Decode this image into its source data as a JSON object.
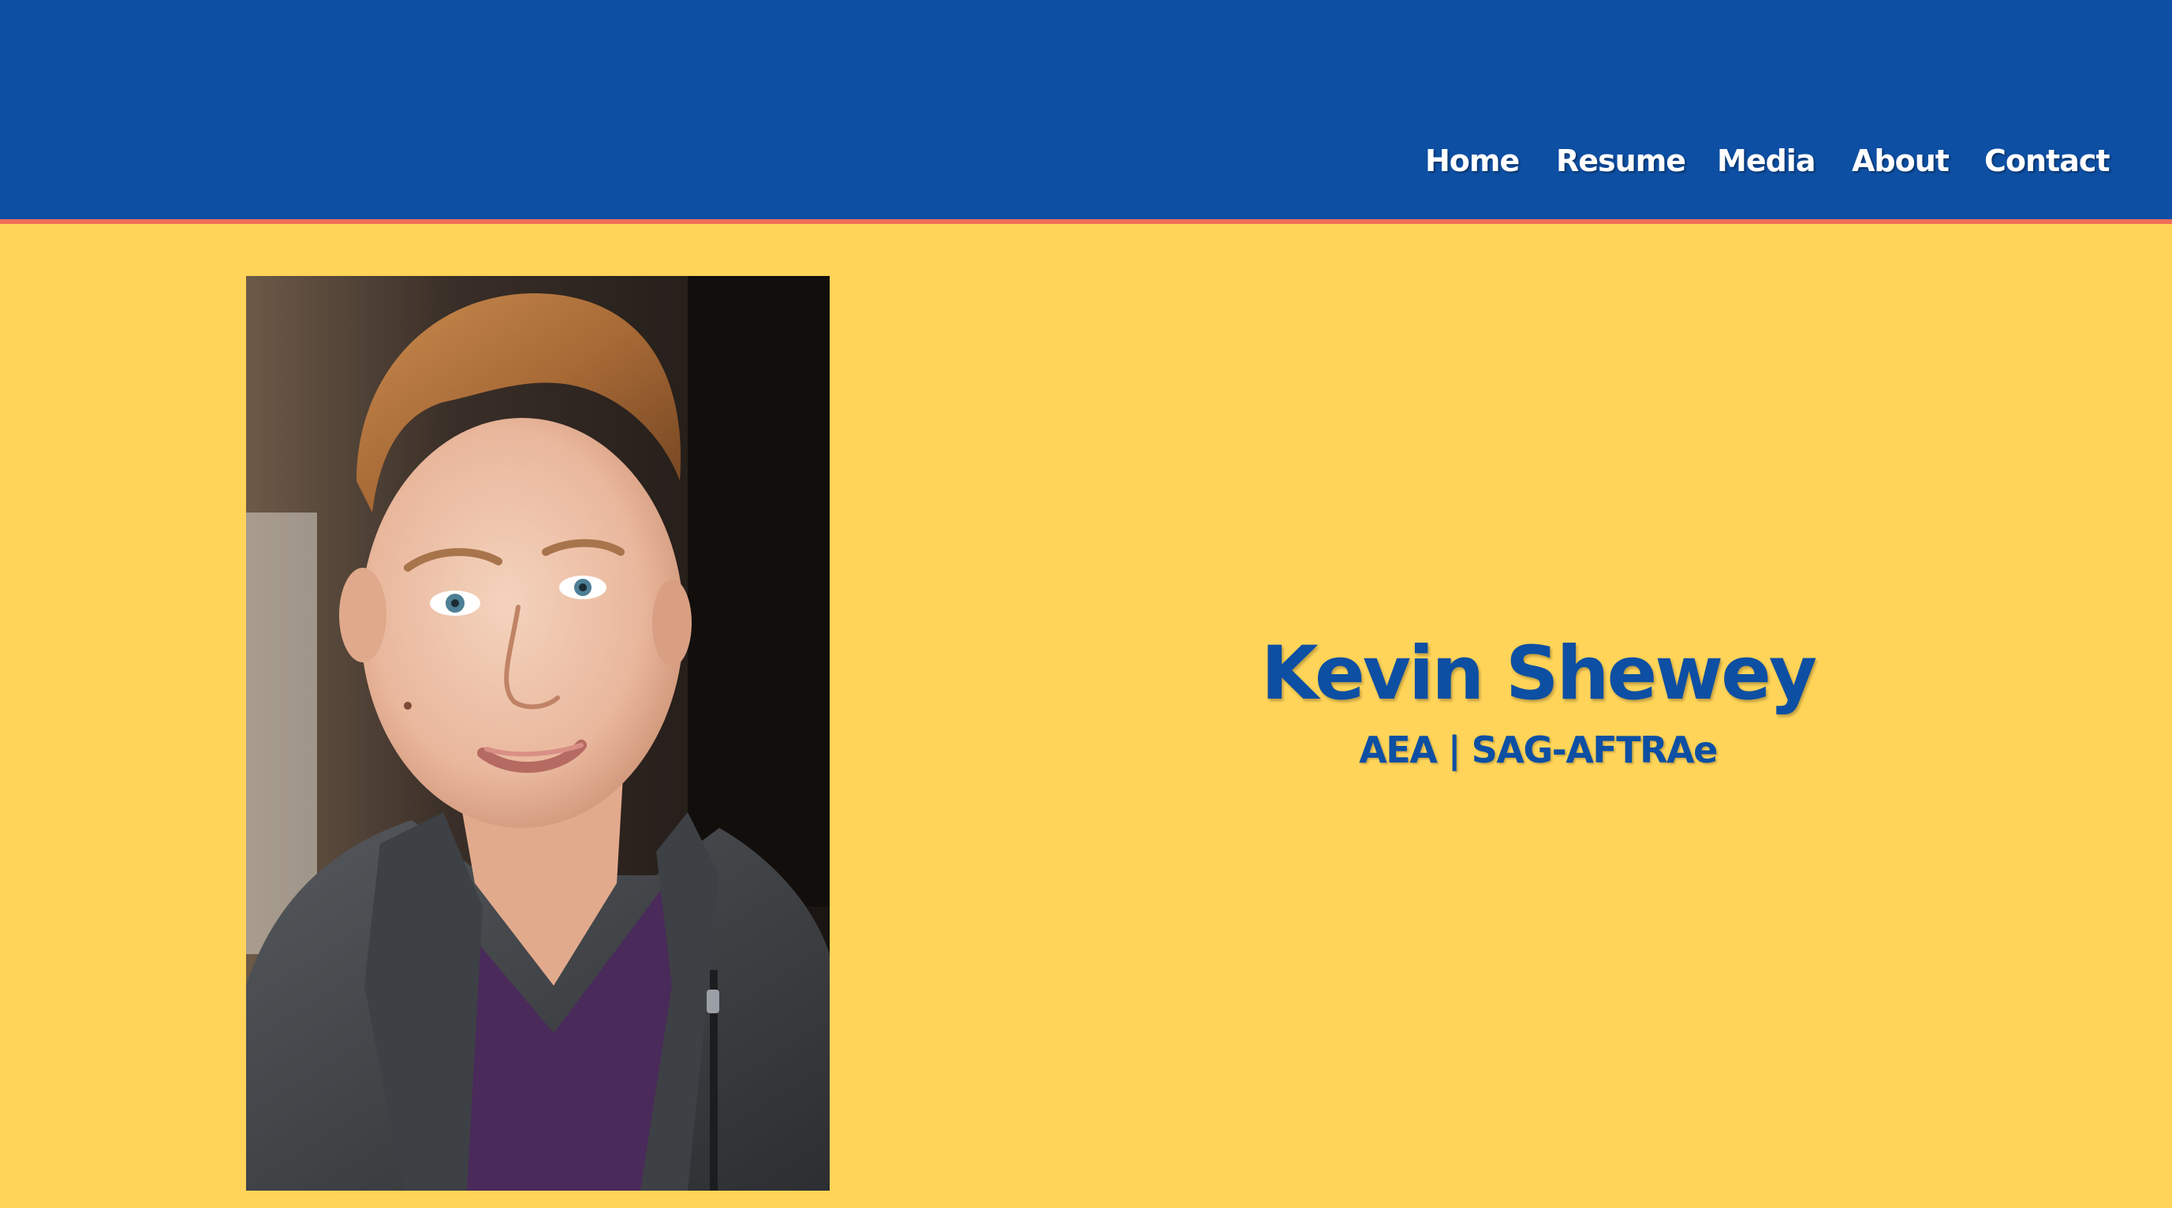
{
  "colors": {
    "header_bg": "#0D4FA3",
    "header_accent_line": "#F26D5B",
    "page_bg": "#FFD459",
    "title_text": "#0D4FA3",
    "nav_text": "#FFFFFF"
  },
  "nav": {
    "items": [
      {
        "label": "Home"
      },
      {
        "label": "Resume"
      },
      {
        "label": "Media"
      },
      {
        "label": "About"
      },
      {
        "label": "Contact"
      }
    ]
  },
  "hero": {
    "headshot_icon": "headshot-photo",
    "name": "Kevin Shewey",
    "unions": "AEA | SAG-AFTRAe"
  }
}
